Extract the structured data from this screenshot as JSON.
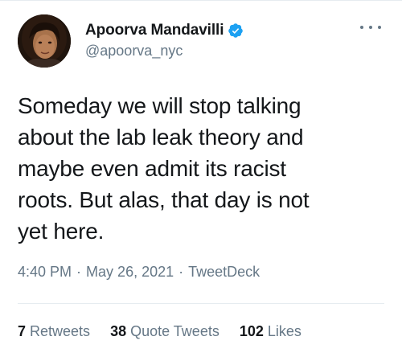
{
  "author": {
    "display_name": "Apoorva Mandavilli",
    "handle": "@apoorva_nyc",
    "verified": true,
    "avatar_icon": "profile-photo"
  },
  "tweet": {
    "text_lines": [
      "Someday we will stop talking",
      "about the lab leak theory and",
      "maybe even admit its racist",
      "roots. But alas, that day is not",
      "yet here."
    ],
    "time": "4:40 PM",
    "date": "May 26, 2021",
    "source": "TweetDeck",
    "separator": "·"
  },
  "stats": {
    "retweets_count": "7",
    "retweets_label": "Retweets",
    "quote_tweets_count": "38",
    "quote_tweets_label": "Quote Tweets",
    "likes_count": "102",
    "likes_label": "Likes"
  },
  "colors": {
    "text_primary": "#14171a",
    "text_secondary": "#657786",
    "verified_blue": "#1da1f2",
    "divider": "#e6ecf0"
  }
}
